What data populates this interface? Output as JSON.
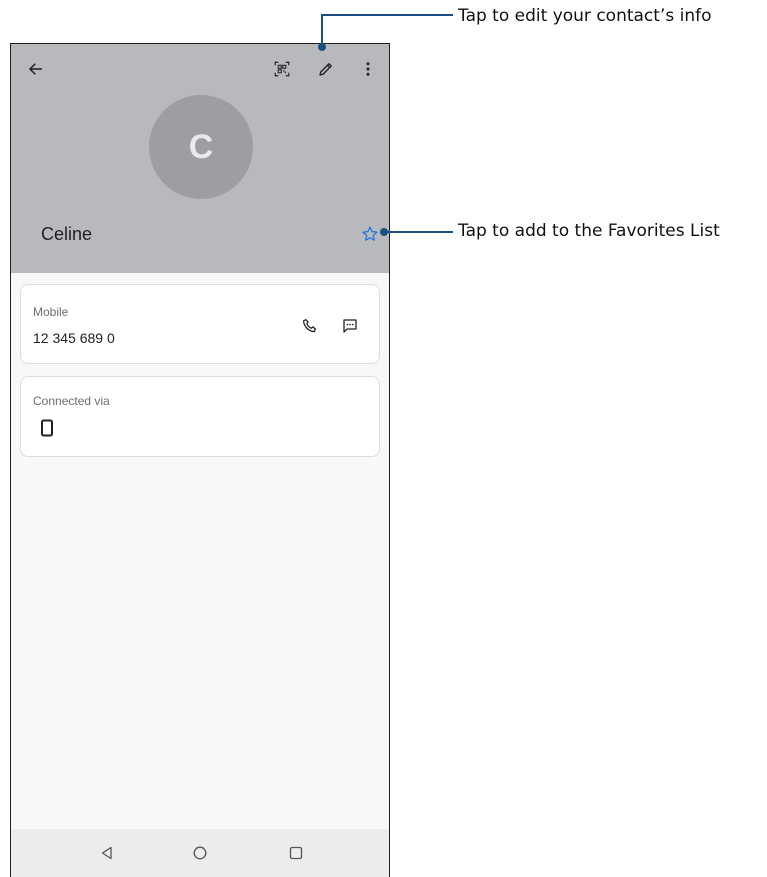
{
  "contact": {
    "initial": "C",
    "name": "Celine"
  },
  "phone_card": {
    "label": "Mobile",
    "number": "12 345 689 0"
  },
  "connected_card": {
    "label": "Connected via"
  },
  "icons": {
    "back": "arrow-left-icon",
    "qr": "qr-code-icon",
    "edit": "pencil-icon",
    "more": "more-vert-icon",
    "favorite": "star-outline-icon",
    "call": "phone-icon",
    "message": "message-icon",
    "device": "smartphone-icon",
    "nav_back": "triangle-back-icon",
    "nav_home": "circle-home-icon",
    "nav_recents": "square-recents-icon"
  },
  "callouts": {
    "edit": "Tap to edit your contact’s info",
    "favorites": "Tap to add to the Favorites List"
  },
  "colors": {
    "header_bg": "#b7b9bc",
    "avatar_bg": "#9c9ea1",
    "star": "#1a73e8",
    "callout": "#1b4f82"
  }
}
